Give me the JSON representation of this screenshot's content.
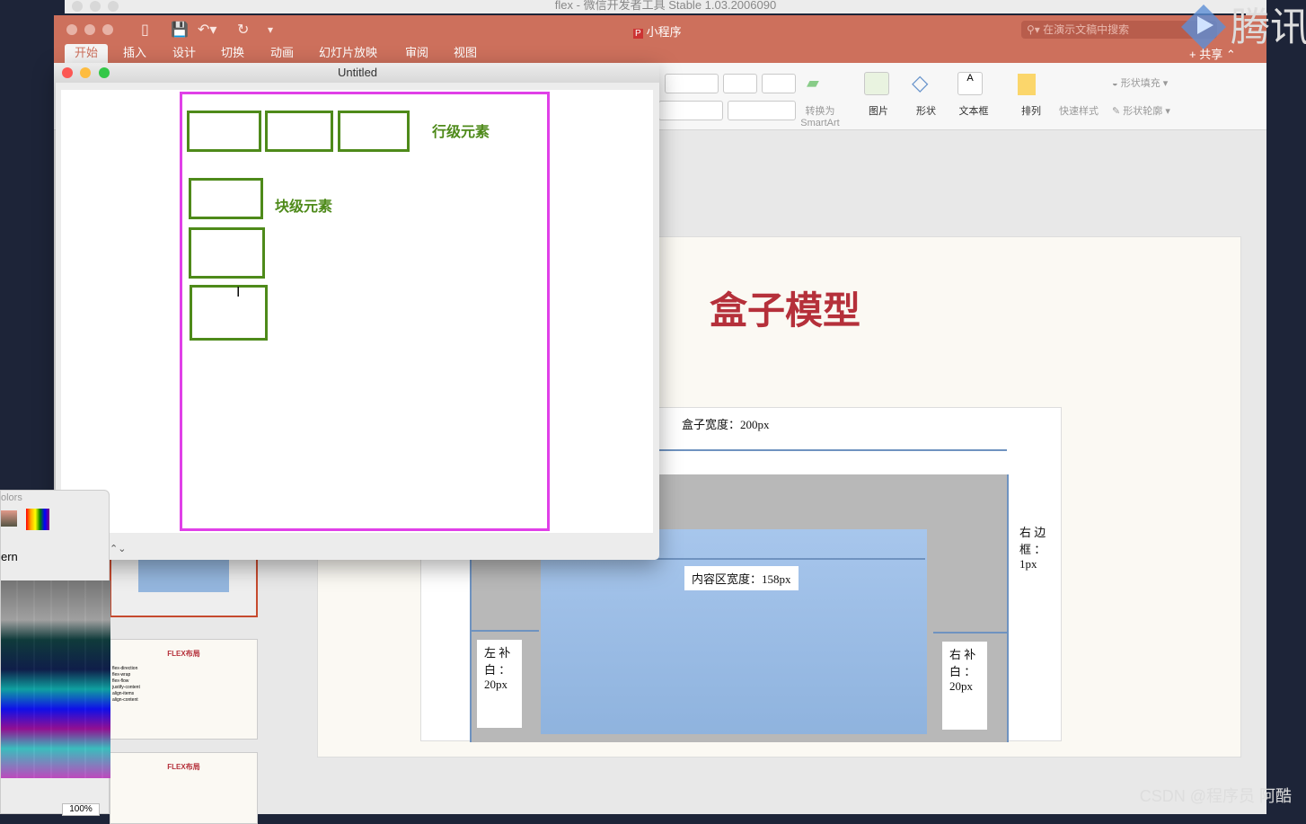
{
  "devtools": {
    "title": "flex - 微信开发者工具 Stable 1.03.2006090"
  },
  "ppt": {
    "doc_title": "小程序",
    "search_placeholder": "在演示文稿中搜索",
    "share": "共享",
    "tabs": [
      {
        "label": "开始",
        "active": true
      },
      {
        "label": "插入"
      },
      {
        "label": "设计"
      },
      {
        "label": "切换"
      },
      {
        "label": "动画"
      },
      {
        "label": "幻灯片放映"
      },
      {
        "label": "审阅"
      },
      {
        "label": "视图"
      }
    ],
    "ribbon": {
      "smartart": "转换为",
      "smartart2": "SmartArt",
      "picture": "图片",
      "shape": "形状",
      "textbox": "文本框",
      "arrange": "排列",
      "quick_style": "快速样式",
      "shape_fill": "形状填充",
      "shape_outline": "形状轮廓"
    },
    "slide": {
      "title": "盒子模型",
      "box_width": "盒子宽度：200px",
      "content_width": "内容区宽度：158px",
      "right_border": "右 边 框 ： 1px",
      "left_padding": "左 补 白 ： 20px",
      "right_padding": "右 补 白 ： 20px"
    },
    "thumbnails": [
      {
        "title": "FLEX布局",
        "items": [
          "flex-direction",
          "flex-wrap",
          "flex-flow",
          "justify-content",
          "align-items",
          "align-content"
        ]
      },
      {
        "title": "FLEX布局"
      }
    ]
  },
  "untitled": {
    "title": "Untitled",
    "inline_label": "行级元素",
    "block_label": "块级元素"
  },
  "colors_panel": {
    "title": "olors",
    "pattern": "ern",
    "opacity": "100%"
  },
  "logo_text": "腾讯",
  "watermark": "CSDN @程序员 阿酷",
  "accent": {
    "ppt_orange": "#cd705c",
    "green": "#4e8a1a",
    "magenta": "#e040e8",
    "slide_red": "#b5303a"
  }
}
